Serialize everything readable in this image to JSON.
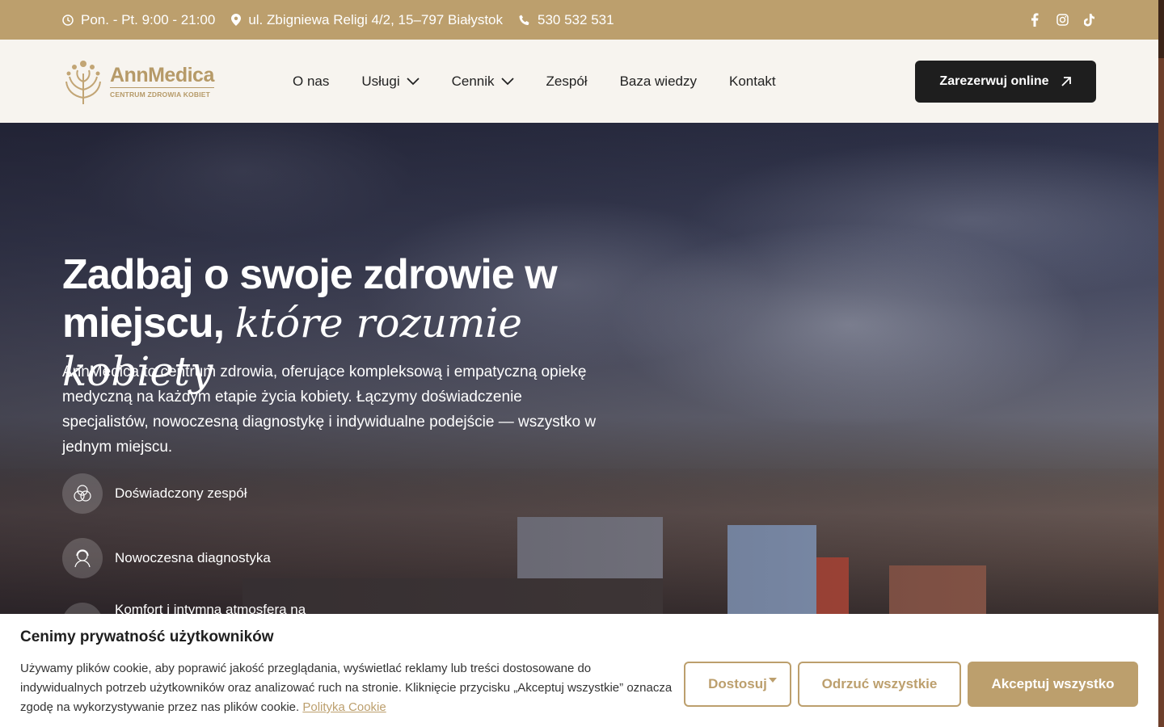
{
  "topbar": {
    "hours": "Pon. - Pt. 9:00 - 21:00",
    "address": "ul. Zbigniewa Religi 4/2, 15–797 Białystok",
    "phone": "530 532 531",
    "social_icons": [
      "facebook-icon",
      "instagram-icon",
      "tiktok-icon"
    ]
  },
  "header": {
    "logo_brand": "AnnMedica",
    "logo_sub": "CENTRUM ZDROWIA KOBIET",
    "nav": [
      "O nas",
      "Usługi",
      "Cennik",
      "Zespół",
      "Baza wiedzy",
      "Kontakt"
    ],
    "cta": "Zarezerwuj online"
  },
  "hero": {
    "title_main": "Zadbaj o swoje zdrowie w miejscu, ",
    "title_em": "które rozumie kobiety",
    "description": "AnnMedica to centrum zdrowia, oferujące kompleksową i empatyczną opiekę medyczną na każdym etapie życia kobiety. Łączymy doświadczenie specjalistów, nowoczesną diagnostykę i indywidualne podejście — wszystko w jednym miejscu.",
    "features": [
      "Doświadczony zespół",
      "Nowoczesna diagnostyka",
      "Komfort i intymna atmosfera na"
    ]
  },
  "cookie": {
    "title": "Cenimy prywatność użytkowników",
    "text": "Używamy plików cookie, aby poprawić jakość przeglądania, wyświetlać reklamy lub treści dostosowane do indywidualnych potrzeb użytkowników oraz analizować ruch na stronie. Kliknięcie przycisku „Akceptuj wszystkie” oznacza zgodę na wykorzystywanie przez nas plików cookie. ",
    "link": "Polityka Cookie",
    "customize": "Dostosuj",
    "reject": "Odrzuć wszystkie",
    "accept": "Akceptuj wszystko"
  },
  "colors": {
    "gold": "#bc9f6d",
    "dark": "#1e1e1e",
    "cream": "#f7f4ef"
  }
}
